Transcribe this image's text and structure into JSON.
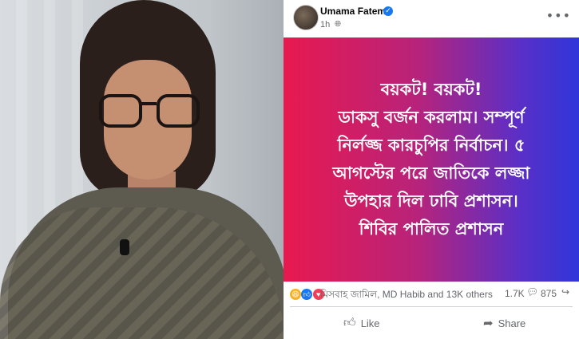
{
  "post": {
    "author": "Umama Fatema",
    "time": "1h",
    "banner_lines": [
      "বয়কট! বয়কট!",
      "ডাকসু বর্জন করলাম। সম্পূর্ণ",
      "নির্লজ্জ কারচুপির নির্বাচন। ৫",
      "আগস্টের পরে জাতিকে লজ্জা",
      "উপহার দিল ঢাবি প্রশাসন।",
      "শিবির পালিত প্রশাসন"
    ],
    "banner_colors": [
      "#e8194f",
      "#b8237a",
      "#5a2fc7",
      "#2f36d9"
    ],
    "reactions_text": "মিসবাহ জামিল, MD Habib and 13K others",
    "comments_count": "1.7K",
    "shares_count": "875",
    "like_label": "Like",
    "share_label": "Share"
  },
  "icons": {
    "verified": "verified-badge-icon",
    "globe": "globe-icon",
    "more": "more-options-icon",
    "haha": "haha-reaction-icon",
    "like": "like-reaction-icon",
    "love": "love-reaction-icon",
    "comment": "comment-icon",
    "share": "share-icon",
    "like_action": "thumbs-up-icon",
    "share_action": "share-arrow-icon"
  }
}
